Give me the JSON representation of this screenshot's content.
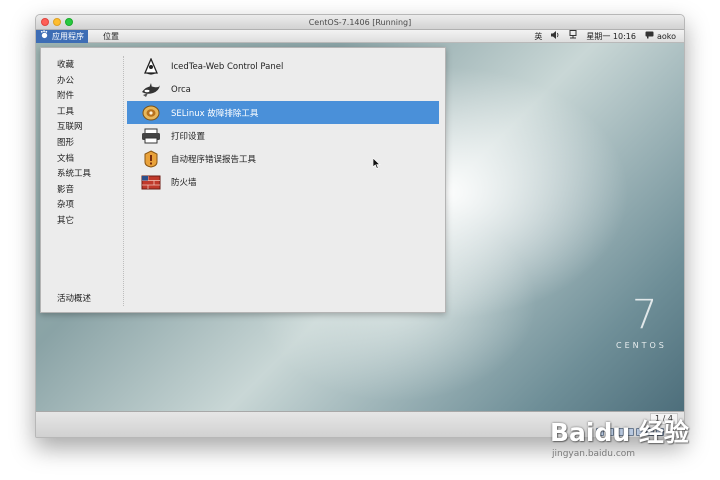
{
  "window": {
    "title": "CentOS-7.1406 [Running]"
  },
  "topbar": {
    "applications_label": "应用程序",
    "places_label": "位置",
    "input_method": "英",
    "datetime": "星期一 10:16",
    "username": "aoko"
  },
  "menu": {
    "categories": [
      "收藏",
      "办公",
      "附件",
      "工具",
      "互联网",
      "图形",
      "文档",
      "系统工具",
      "影音",
      "杂项",
      "其它"
    ],
    "activities": "活动概述",
    "apps": [
      {
        "label": "IcedTea-Web Control Panel",
        "icon": "java-icon",
        "selected": false
      },
      {
        "label": "Orca",
        "icon": "orca-icon",
        "selected": false
      },
      {
        "label": "SELinux 故障排除工具",
        "icon": "selinux-icon",
        "selected": true
      },
      {
        "label": "打印设置",
        "icon": "printer-icon",
        "selected": false
      },
      {
        "label": "自动程序错误报告工具",
        "icon": "bug-report-icon",
        "selected": false
      },
      {
        "label": "防火墙",
        "icon": "firewall-icon",
        "selected": false
      }
    ]
  },
  "desktop": {
    "brand_number": "7",
    "brand_text": "CENTOS"
  },
  "status": {
    "page_indicator": "1 / 4"
  },
  "watermark": {
    "text": "Baidu 经验",
    "url": "jingyan.baidu.com"
  },
  "colors": {
    "selection": "#4a90d9",
    "apps_menu_bg": "#3d6db5"
  }
}
